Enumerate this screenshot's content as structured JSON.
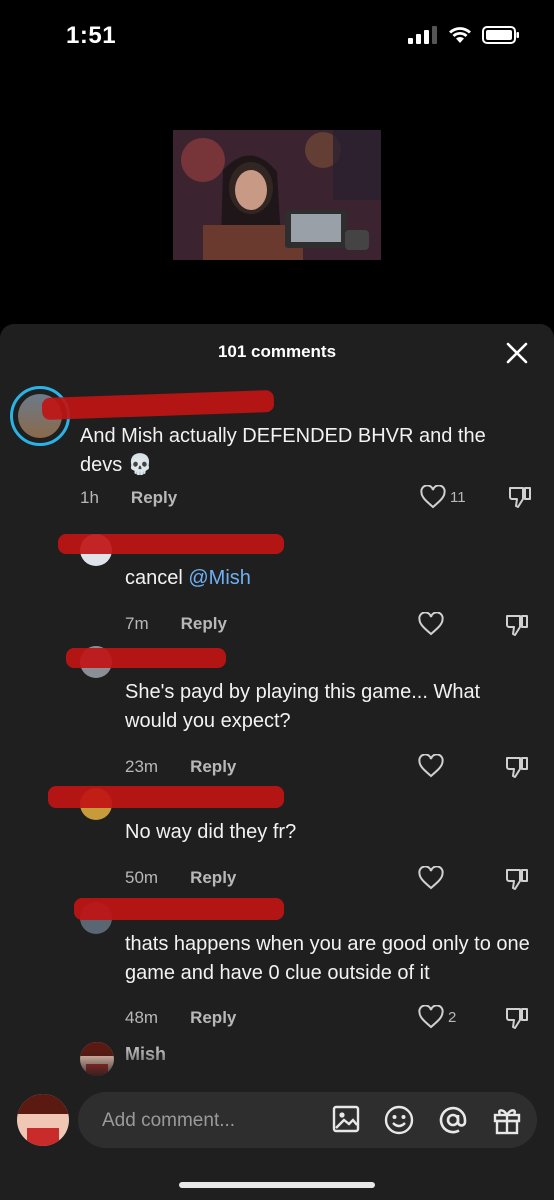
{
  "status": {
    "time": "1:51"
  },
  "sheet": {
    "title": "101 comments"
  },
  "comments": [
    {
      "text": "And Mish actually DEFENDED BHVR and the devs 💀",
      "time": "1h",
      "reply": "Reply",
      "likes": "11"
    },
    {
      "text_prefix": "cancel ",
      "mention": "@Mish",
      "time": "7m",
      "reply": "Reply"
    },
    {
      "text": "She's payd by playing this game... What would you expect?",
      "time": "23m",
      "reply": "Reply"
    },
    {
      "text": "No way did they fr?",
      "time": "50m",
      "reply": "Reply"
    },
    {
      "text": "thats happens when you are good only to one game and have 0 clue outside of it",
      "time": "48m",
      "reply": "Reply",
      "likes": "2"
    },
    {
      "author": "Mish"
    }
  ],
  "composer": {
    "placeholder": "Add comment..."
  }
}
